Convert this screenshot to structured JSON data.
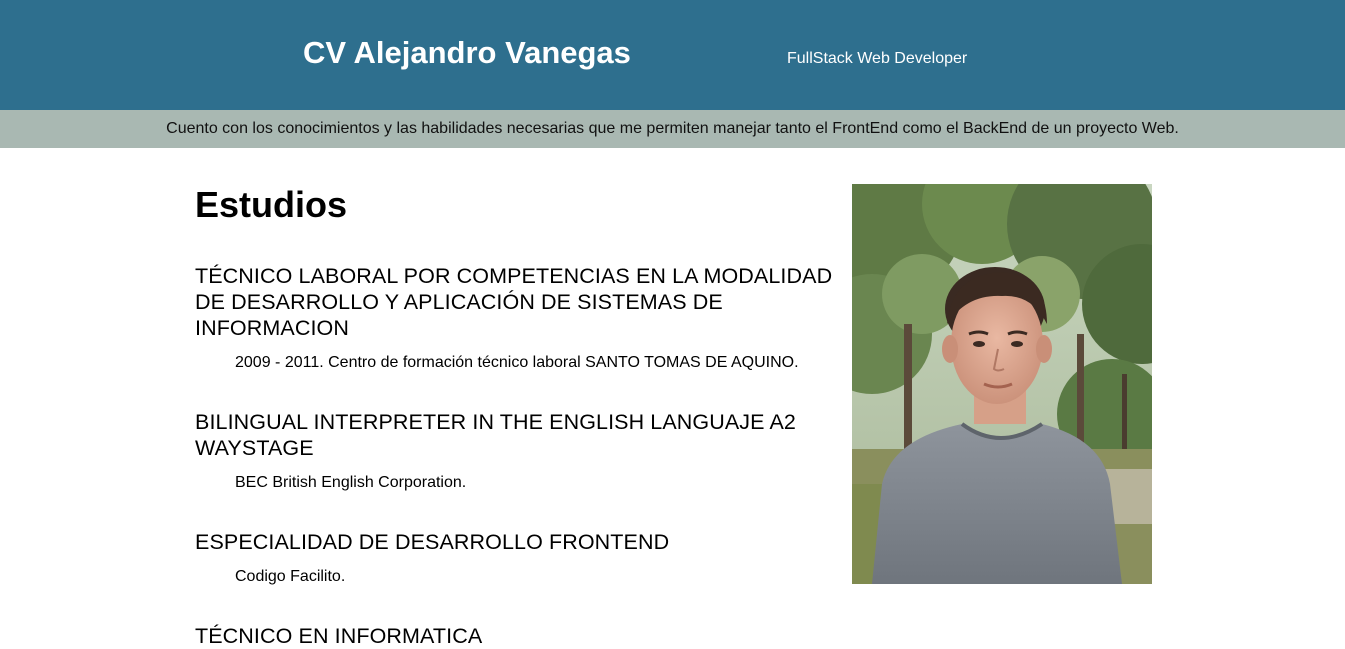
{
  "header": {
    "title": "CV Alejandro Vanegas",
    "subtitle": "FullStack Web Developer"
  },
  "summary": "Cuento con los conocimientos y las habilidades necesarias que me permiten manejar tanto el FrontEnd como el BackEnd de un proyecto Web.",
  "studies": {
    "heading": "Estudios",
    "items": [
      {
        "title": "TÉCNICO LABORAL POR COMPETENCIAS EN LA MODALIDAD DE DESARROLLO Y APLICACIÓN DE SISTEMAS DE INFORMACION",
        "detail": "2009 - 2011. Centro de formación técnico laboral SANTO TOMAS DE AQUINO."
      },
      {
        "title": "BILINGUAL INTERPRETER IN THE ENGLISH LANGUAJE A2 WAYSTAGE",
        "detail": "BEC British English Corporation."
      },
      {
        "title": "ESPECIALIDAD DE DESARROLLO FRONTEND",
        "detail": "Codigo Facilito."
      },
      {
        "title": "TÉCNICO EN INFORMATICA",
        "detail": ""
      }
    ]
  },
  "colors": {
    "header_bg": "#2e6f8e",
    "summary_bg": "#a9b8b2"
  },
  "profile_photo": "profile-photo"
}
